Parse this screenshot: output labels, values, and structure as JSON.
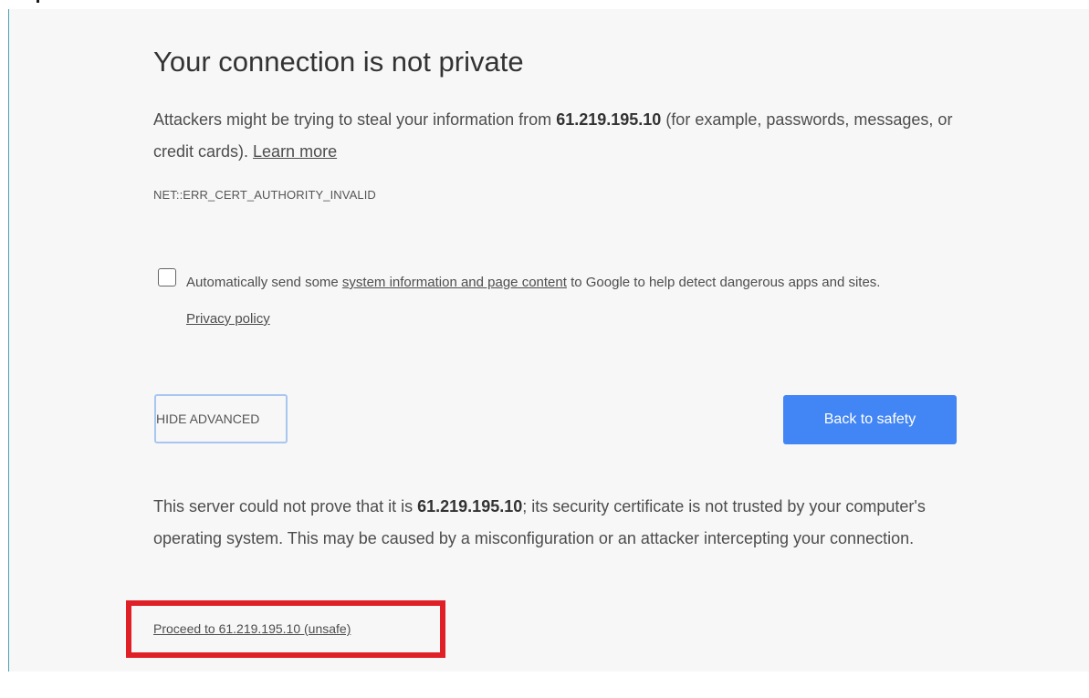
{
  "title": "Your connection is not private",
  "main_message": {
    "part1": "Attackers might be trying to steal your information from ",
    "host": "61.219.195.10",
    "part2": " (for example, passwords, messages, or credit cards). ",
    "learn_more": "Learn more"
  },
  "error_code": "NET::ERR_CERT_AUTHORITY_INVALID",
  "checkbox_option": {
    "checked": false,
    "part1": "Automatically send some ",
    "link1": "system information and page content",
    "part2": " to Google to help detect dangerous apps and sites. ",
    "link2": "Privacy policy"
  },
  "buttons": {
    "hide_advanced": "HIDE ADVANCED",
    "back_to_safety": "Back to safety"
  },
  "details": {
    "part1": "This server could not prove that it is ",
    "host": "61.219.195.10",
    "part2": "; its security certificate is not trusted by your computer's operating system. This may be caused by a misconfiguration or an attacker intercepting your connection."
  },
  "proceed_link": "Proceed to 61.219.195.10 (unsafe)",
  "colors": {
    "page_background": "#f7f7f7",
    "primary_button": "#4285f4",
    "highlight_annotation": "#e02027",
    "left_border": "#4aa3b8"
  }
}
